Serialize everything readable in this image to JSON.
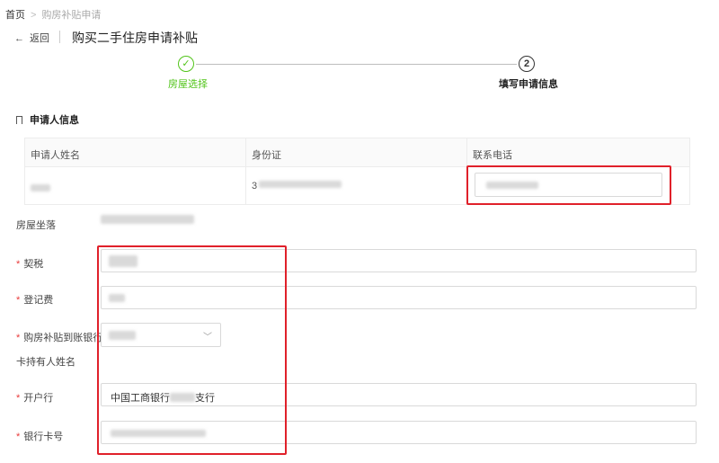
{
  "breadcrumb": {
    "home": "首页",
    "separator": ">",
    "current": "购房补贴申请"
  },
  "header": {
    "back_label": "返回",
    "title": "购买二手住房申请补贴"
  },
  "steps": [
    {
      "label": "房屋选择",
      "icon": "check-icon",
      "status": "done"
    },
    {
      "label": "填写申请信息",
      "number": "2",
      "status": "active"
    }
  ],
  "section": {
    "title": "申请人信息"
  },
  "applicant_table": {
    "columns": [
      "申请人姓名",
      "身份证",
      "联系电话"
    ],
    "id_prefix": "3"
  },
  "form": {
    "address_label": "房屋坐落",
    "deed_tax_label": "契税",
    "registration_fee_label": "登记费",
    "bank_label": "购房补贴到账银行",
    "cardholder_label": "卡持有人姓名",
    "branch_label": "开户行",
    "branch_value_prefix": "中国工商银行",
    "branch_value_suffix": "支行",
    "card_no_label": "银行卡号",
    "required_mark": "*"
  },
  "colors": {
    "success": "#52c41a",
    "required": "#e83a3a",
    "highlight": "#e0202a"
  }
}
